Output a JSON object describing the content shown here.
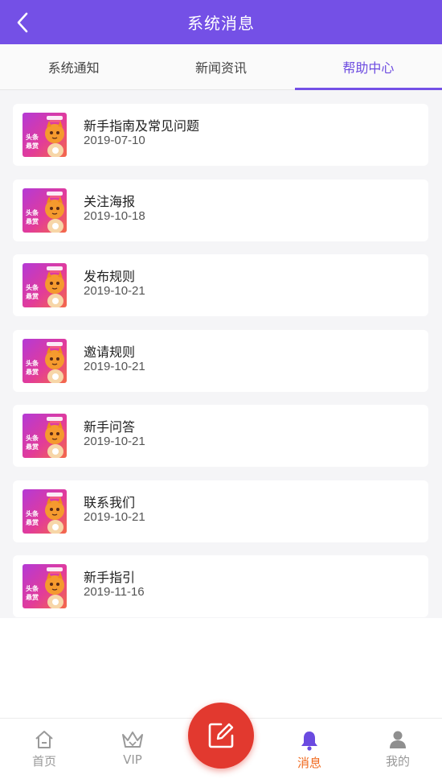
{
  "header": {
    "title": "系统消息",
    "back_icon": "chevron-left-icon"
  },
  "tabs": [
    {
      "label": "系统通知",
      "active": false
    },
    {
      "label": "新闻资讯",
      "active": false
    },
    {
      "label": "帮助中心",
      "active": true
    }
  ],
  "thumbnail": {
    "text_line1": "头条",
    "text_line2": "悬赏"
  },
  "items": [
    {
      "title": "新手指南及常见问题",
      "date": "2019-07-10"
    },
    {
      "title": "关注海报",
      "date": "2019-10-18"
    },
    {
      "title": "发布规则",
      "date": "2019-10-21"
    },
    {
      "title": "邀请规则",
      "date": "2019-10-21"
    },
    {
      "title": "新手问答",
      "date": "2019-10-21"
    },
    {
      "title": "联系我们",
      "date": "2019-10-21"
    },
    {
      "title": "新手指引",
      "date": "2019-11-16"
    }
  ],
  "bottom_nav": {
    "home": {
      "label": "首页",
      "icon": "home-icon"
    },
    "vip": {
      "label": "VIP",
      "icon": "crown-icon"
    },
    "publish": {
      "icon": "edit-icon"
    },
    "messages": {
      "label": "消息",
      "icon": "bell-icon",
      "active": true
    },
    "mine": {
      "label": "我的",
      "icon": "user-icon"
    }
  },
  "colors": {
    "primary": "#7450e6",
    "accent": "#f06a1f",
    "fab": "#e2392f"
  }
}
